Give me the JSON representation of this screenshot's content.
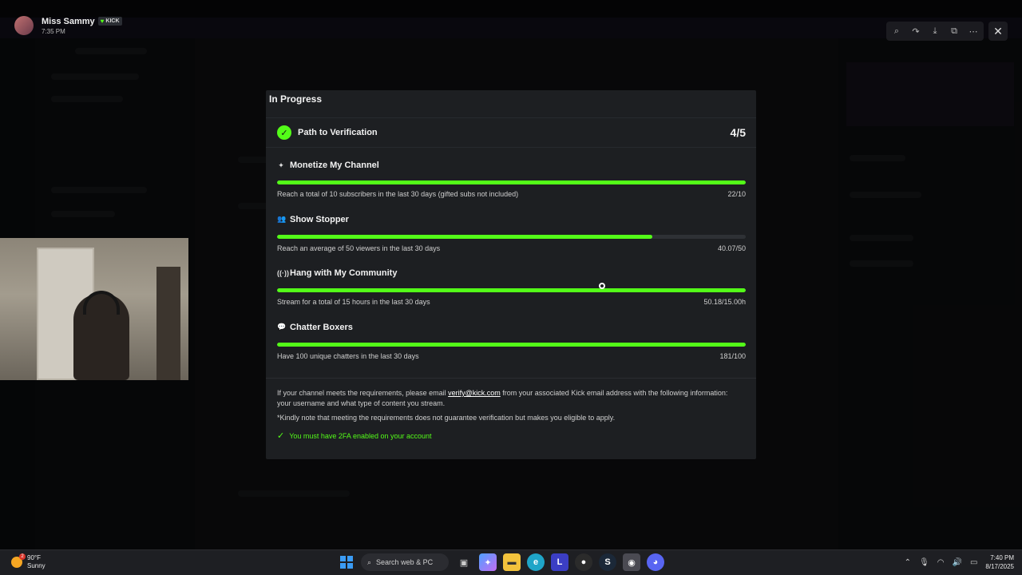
{
  "viewer": {
    "name": "Miss Sammy",
    "badge": "KICK",
    "time": "7:35 PM"
  },
  "panel": {
    "title": "In Progress",
    "path_label": "Path to Verification",
    "path_count": "4/5",
    "requirements": [
      {
        "title": "Monetize My Channel",
        "icon": "sparkle-icon",
        "description": "Reach a total of 10 subscribers in the last 30 days (gifted subs not included)",
        "value": "22/10",
        "progress": 1.0
      },
      {
        "title": "Show Stopper",
        "icon": "users-icon",
        "description": "Reach an average of 50 viewers in the last 30 days",
        "value": "40.07/50",
        "progress": 0.8014
      },
      {
        "title": "Hang with My Community",
        "icon": "broadcast-icon",
        "description": "Stream for a total of 15 hours in the last 30 days",
        "value": "50.18/15.00h",
        "progress": 1.0
      },
      {
        "title": "Chatter Boxers",
        "icon": "chat-icon",
        "description": "Have 100 unique chatters in the last 30 days",
        "value": "181/100",
        "progress": 1.0
      }
    ],
    "info_before": "If your channel meets the requirements, please email ",
    "info_email": "verify@kick.com",
    "info_after": " from your associated Kick email address with the following information: your username and what type of content you stream.",
    "note": "*Kindly note that meeting the requirements does not guarantee verification but makes you eligible to apply.",
    "twofa": "You must have 2FA enabled on your account"
  },
  "taskbar": {
    "temp": "90°F",
    "condition": "Sunny",
    "search_placeholder": "Search web & PC",
    "time": "7:40 PM",
    "date": "8/17/2025"
  },
  "colors": {
    "accent": "#53fc18",
    "panel_bg": "#1d1f22"
  }
}
